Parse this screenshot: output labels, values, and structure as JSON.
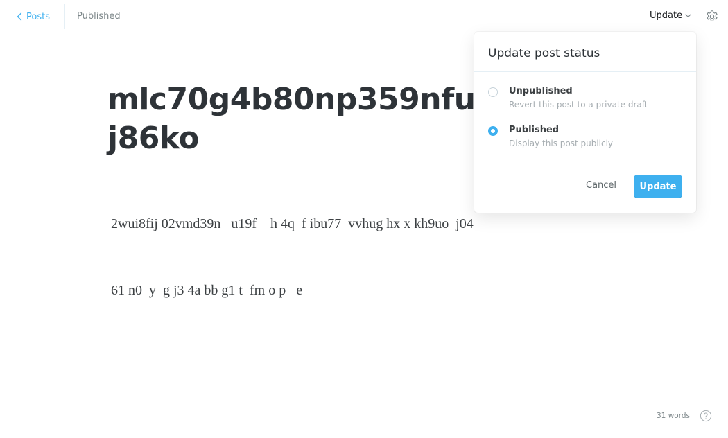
{
  "header": {
    "back_label": "Posts",
    "post_status": "Published",
    "update_label": "Update"
  },
  "editor": {
    "title_lines": [
      "mlc70g4b80np359nfutc",
      "j86ko"
    ],
    "body_lines": [
      "2wui8fij 02vmd39n   u19f    h 4q  f ibu77  vvhug hx x kh9uo  j04",
      "61 n0  y  g j3 4a bb g1 t  fm o p   e"
    ]
  },
  "popover": {
    "title": "Update post status",
    "options": [
      {
        "label": "Unpublished",
        "description": "Revert this post to a private draft",
        "selected": false
      },
      {
        "label": "Published",
        "description": "Display this post publicly",
        "selected": true
      }
    ],
    "cancel_label": "Cancel",
    "update_label": "Update"
  },
  "footer": {
    "word_count": "31 words"
  },
  "colors": {
    "accent": "#3eb0ef",
    "text": "#15171a",
    "muted": "#7d878a"
  },
  "icons": [
    "chevron-left-icon",
    "chevron-down-icon",
    "gear-icon",
    "help-icon"
  ]
}
